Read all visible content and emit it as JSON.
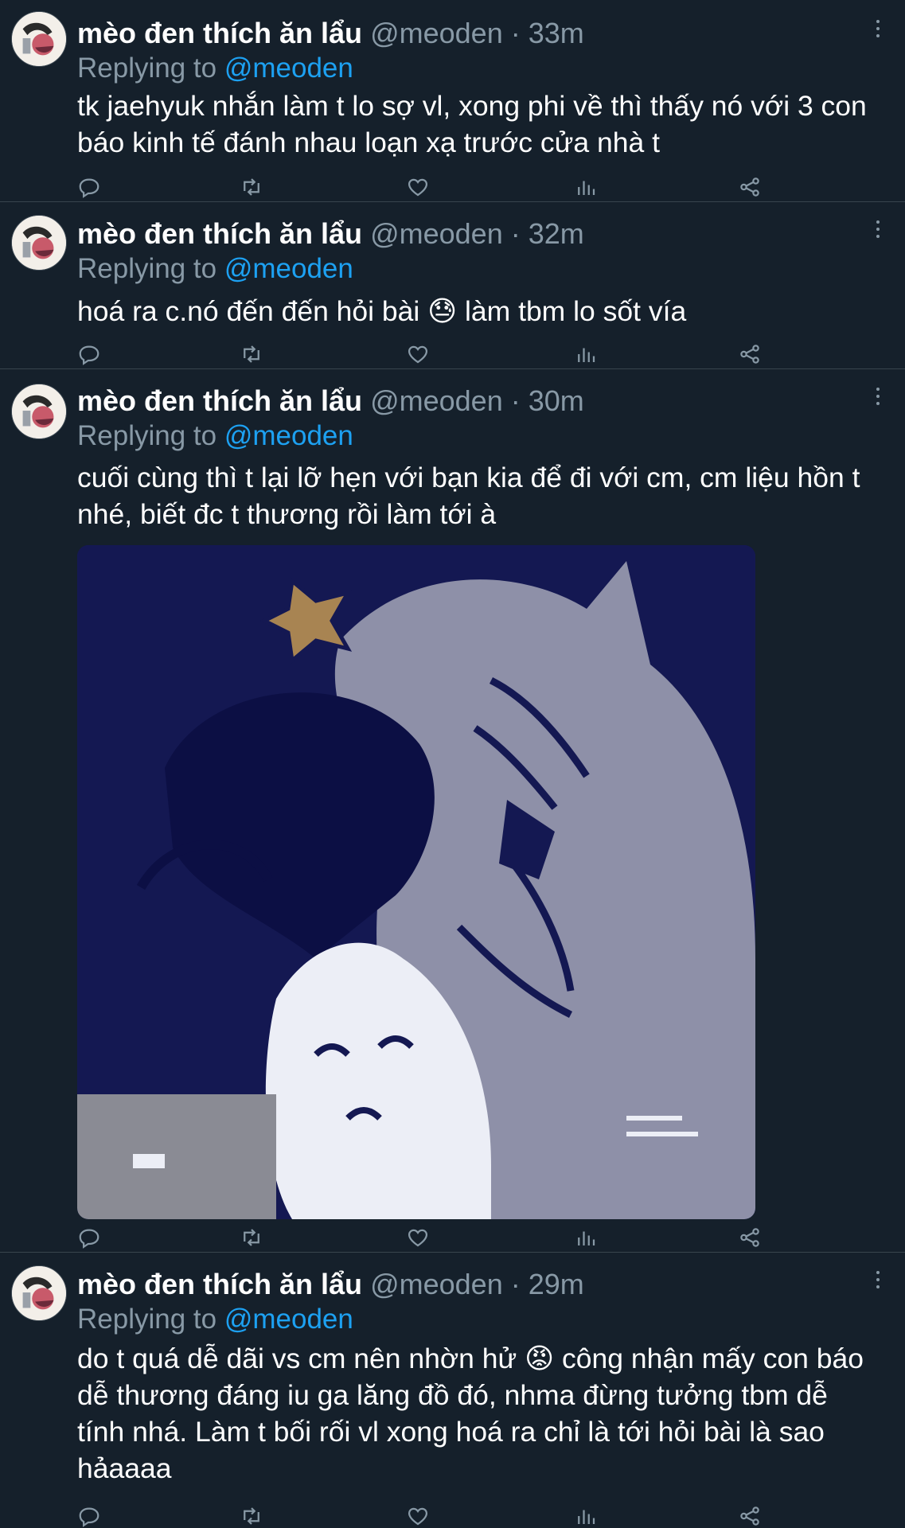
{
  "tweets": [
    {
      "name": "mèo đen thích ăn lẩu",
      "handle": "@meoden",
      "dot": "·",
      "time": "33m",
      "replying_prefix": "Replying to",
      "replying_to": "@meoden",
      "text": "tk jaehyuk nhắn làm t lo sợ vl, xong phi về thì thấy nó với 3 con báo kinh tế đánh nhau loạn xạ trước cửa nhà t"
    },
    {
      "name": "mèo đen thích ăn lẩu",
      "handle": "@meoden",
      "dot": "·",
      "time": "32m",
      "replying_prefix": "Replying to",
      "replying_to": "@meoden",
      "text": "hoá ra c.nó đến đến hỏi bài 😓 làm tbm lo sốt vía"
    },
    {
      "name": "mèo đen thích ăn lẩu",
      "handle": "@meoden",
      "dot": "·",
      "time": "30m",
      "replying_prefix": "Replying to",
      "replying_to": "@meoden",
      "text": "cuối cùng thì t lại lỡ hẹn với bạn kia để đi với cm, cm liệu hồn t nhé, biết đc t thương rồi làm tới à"
    },
    {
      "name": "mèo đen thích ăn lẩu",
      "handle": "@meoden",
      "dot": "·",
      "time": "29m",
      "replying_prefix": "Replying to",
      "replying_to": "@meoden",
      "text": "do t quá dễ dãi vs cm nên nhờn hử 😡 công nhận mấy con báo dễ thương đáng iu ga lăng đồ đó, nhma đừng tưởng tbm dễ tính nhá. Làm t bối rối vl xong hoá ra chỉ là tới hỏi bài là sao hảaaaa"
    }
  ],
  "action_icons": [
    "reply-icon",
    "retweet-icon",
    "like-icon",
    "analytics-icon",
    "share-icon"
  ],
  "more_icon": "more-options-icon",
  "colors": {
    "background": "#15202b",
    "divider": "#38444d",
    "secondary_text": "#8899a6",
    "accent": "#1da1f2"
  }
}
